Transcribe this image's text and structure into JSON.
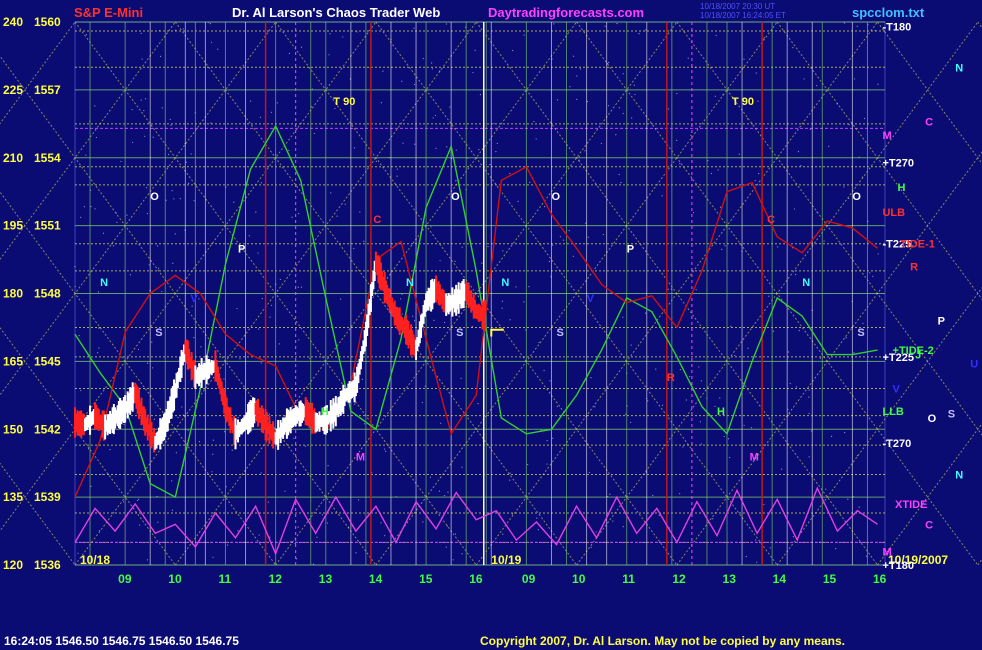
{
  "header": {
    "instrument": "S&P E-Mini",
    "title": "Dr. Al Larson's Chaos Trader Web",
    "site": "Daytradingforecasts.com",
    "timestamp_line1": "10/18/2007 20:30 UT",
    "timestamp_line2": "10/18/2007 16:24:05 ET",
    "filename": "spcclom.txt"
  },
  "footer": {
    "quote": "16:24:05  1546.50  1546.75  1546.50  1546.75",
    "copyright": "Copyright 2007, Dr. Al Larson. May not be copied by any means."
  },
  "colors": {
    "background": "#0b0b74",
    "plot_background": "#0b0b74",
    "grid_yellow": "#e8e85a",
    "grid_green": "#7fd16a",
    "vertical_white": "#ffffff",
    "vertical_red": "#c01818",
    "price_up": "#ffffff",
    "price_down": "#ff2020",
    "green_line": "#30d030",
    "red_line": "#d01010",
    "magenta_line": "#e040e0",
    "title_red": "#ff3030",
    "title_white": "#ffffff",
    "site_magenta": "#ff40ff",
    "filename_cyan": "#40c0ff"
  },
  "chart_data": {
    "type": "line",
    "title": "S&P E-Mini",
    "ylim": [
      1536,
      1560
    ],
    "y_ticks_price": [
      1560,
      1557,
      1554,
      1551,
      1548,
      1545,
      1542,
      1539,
      1536
    ],
    "y_ticks_degrees": [
      240,
      225,
      210,
      195,
      180,
      165,
      150,
      135,
      120
    ],
    "xlim": [
      8.0,
      32.15
    ],
    "x_tick_labels": [
      "09",
      "10",
      "11",
      "12",
      "13",
      "14",
      "15",
      "16",
      "09",
      "10",
      "11",
      "12",
      "13",
      "14",
      "15",
      "16"
    ],
    "x_tick_positions": [
      9,
      10,
      11,
      12,
      13,
      14,
      15,
      16,
      17.05,
      18.05,
      19.05,
      20.05,
      21.05,
      22.05,
      23.05,
      24.05
    ],
    "date_labels": [
      {
        "text": "10/18",
        "x": 8.1
      },
      {
        "text": "10/19",
        "x": 16.3
      },
      {
        "text": "10/19/2007",
        "x": 32.15
      }
    ],
    "series": [
      {
        "name": "",
        "kind": "price",
        "x": [
          8.0,
          8.2,
          8.4,
          8.6,
          8.8,
          9.0,
          9.2,
          9.4,
          9.6,
          9.8,
          10.0,
          10.2,
          10.4,
          10.6,
          10.8,
          11.0,
          11.2,
          11.4,
          11.6,
          11.8,
          12.0,
          12.2,
          12.4,
          12.6,
          12.8,
          13.0,
          13.2,
          13.4,
          13.6,
          13.8,
          14.0,
          14.2,
          14.4,
          14.6,
          14.8,
          15.0,
          15.2,
          15.4,
          15.6,
          15.8,
          16.0,
          16.2
        ],
        "values": [
          1542.3,
          1542.2,
          1542.6,
          1542.1,
          1542.5,
          1542.9,
          1543.6,
          1542.3,
          1541.4,
          1542.2,
          1543.7,
          1545.6,
          1544.3,
          1544.6,
          1544.8,
          1543.0,
          1541.8,
          1542.3,
          1542.9,
          1542.2,
          1541.6,
          1542.2,
          1542.6,
          1542.8,
          1542.3,
          1542.4,
          1542.8,
          1543.5,
          1543.9,
          1546.2,
          1549.4,
          1548.1,
          1547.0,
          1546.4,
          1545.5,
          1547.6,
          1548.2,
          1547.5,
          1547.7,
          1548.1,
          1547.2,
          1547.0
        ]
      },
      {
        "name": "",
        "kind": "green",
        "x": [
          8.0,
          8.5,
          9.0,
          9.5,
          10.0,
          10.5,
          11.0,
          11.5,
          12.0,
          12.5,
          13.0,
          13.5,
          14.0,
          14.5,
          15.0,
          15.5,
          16.0,
          16.5,
          17.0,
          17.5,
          18.0,
          18.5,
          19.0,
          19.5,
          20.0,
          20.5,
          21.0,
          21.5,
          22.0,
          22.5,
          23.0,
          23.5,
          24.0
        ],
        "values": [
          1546.2,
          1544.5,
          1543.0,
          1539.6,
          1539.0,
          1543.8,
          1549.3,
          1553.5,
          1555.4,
          1553.0,
          1547.8,
          1542.8,
          1542.0,
          1546.0,
          1551.8,
          1554.5,
          1549.0,
          1542.5,
          1541.8,
          1542.0,
          1543.5,
          1545.5,
          1547.8,
          1547.2,
          1545.2,
          1543.0,
          1541.8,
          1545.0,
          1547.8,
          1547.0,
          1545.3,
          1545.3,
          1545.5
        ]
      },
      {
        "name": "",
        "kind": "red",
        "x": [
          8.0,
          8.5,
          9.0,
          9.5,
          10.0,
          10.5,
          11.0,
          11.5,
          12.0,
          12.5,
          13.0,
          13.5,
          14.0,
          14.5,
          15.0,
          15.5,
          16.0,
          16.5,
          17.0,
          17.5,
          18.0,
          18.5,
          19.0,
          19.5,
          20.0,
          20.5,
          21.0,
          21.5,
          22.0,
          22.5,
          23.0,
          23.5,
          24.0
        ],
        "values": [
          1539.0,
          1541.5,
          1546.3,
          1548.0,
          1548.8,
          1548.0,
          1546.2,
          1545.3,
          1544.8,
          1542.5,
          1541.9,
          1544.0,
          1549.5,
          1550.3,
          1546.0,
          1541.8,
          1543.5,
          1553.0,
          1553.6,
          1551.5,
          1550.0,
          1548.4,
          1547.6,
          1547.9,
          1546.5,
          1549.0,
          1552.5,
          1552.9,
          1550.5,
          1549.8,
          1551.2,
          1550.9,
          1550.0
        ]
      },
      {
        "name": "",
        "kind": "magenta",
        "x": [
          8.0,
          8.4,
          8.8,
          9.2,
          9.6,
          10.0,
          10.4,
          10.8,
          11.2,
          11.6,
          12.0,
          12.4,
          12.8,
          13.2,
          13.6,
          14.0,
          14.4,
          14.8,
          15.2,
          15.6,
          16.0,
          16.4,
          16.8,
          17.2,
          17.6,
          18.0,
          18.4,
          18.8,
          19.2,
          19.6,
          20.0,
          20.4,
          20.8,
          21.2,
          21.6,
          22.0,
          22.4,
          22.8,
          23.2,
          23.6,
          24.0
        ],
        "values": [
          1537.0,
          1538.5,
          1537.5,
          1538.7,
          1537.4,
          1537.8,
          1536.8,
          1538.3,
          1537.2,
          1538.6,
          1536.5,
          1538.9,
          1537.4,
          1539.0,
          1537.5,
          1538.6,
          1537.0,
          1538.8,
          1537.6,
          1539.2,
          1538.0,
          1538.4,
          1537.1,
          1537.9,
          1536.9,
          1538.6,
          1537.2,
          1539.0,
          1537.4,
          1538.5,
          1537.0,
          1538.8,
          1537.3,
          1539.3,
          1537.4,
          1538.9,
          1537.1,
          1539.4,
          1537.5,
          1538.4,
          1537.8
        ]
      }
    ],
    "annotations": [
      {
        "text": "T 90",
        "x": 13.15,
        "y": 1556.5,
        "color": "#ffff40"
      },
      {
        "text": "T 90",
        "x": 21.1,
        "y": 1556.5,
        "color": "#ffff40"
      },
      {
        "text": "-T180",
        "x": 24.1,
        "y": 1559.8,
        "color": "#ffffff"
      },
      {
        "text": "+T270",
        "x": 24.1,
        "y": 1553.8,
        "color": "#ffffff"
      },
      {
        "text": "-T225",
        "x": 24.1,
        "y": 1550.2,
        "color": "#ffffff"
      },
      {
        "text": "+T225",
        "x": 24.1,
        "y": 1545.2,
        "color": "#ffffff"
      },
      {
        "text": "-T270",
        "x": 24.1,
        "y": 1541.4,
        "color": "#ffffff"
      },
      {
        "text": "+T180",
        "x": 24.1,
        "y": 1536.0,
        "color": "#ffffff"
      },
      {
        "text": "M",
        "x": 24.1,
        "y": 1555.0,
        "color": "#ff40ff"
      },
      {
        "text": "H",
        "x": 24.4,
        "y": 1552.7,
        "color": "#40ff40"
      },
      {
        "text": "ULB",
        "x": 24.1,
        "y": 1551.6,
        "color": "#ff3030"
      },
      {
        "text": "TIDE-1",
        "x": 24.45,
        "y": 1550.2,
        "color": "#ff3030"
      },
      {
        "text": "R",
        "x": 24.65,
        "y": 1549.2,
        "color": "#ff3030"
      },
      {
        "text": "+TIDE-2",
        "x": 24.3,
        "y": 1545.5,
        "color": "#40ff40"
      },
      {
        "text": "V",
        "x": 24.3,
        "y": 1543.8,
        "color": "#3030ff"
      },
      {
        "text": "LLB",
        "x": 24.1,
        "y": 1542.8,
        "color": "#40ff40"
      },
      {
        "text": "O",
        "x": 25.0,
        "y": 1542.5,
        "color": "#ffffff"
      },
      {
        "text": "S",
        "x": 25.4,
        "y": 1542.7,
        "color": "#c0c0ff"
      },
      {
        "text": "P",
        "x": 25.2,
        "y": 1546.8,
        "color": "#ffffff"
      },
      {
        "text": "U",
        "x": 25.85,
        "y": 1544.9,
        "color": "#3030ff"
      },
      {
        "text": "J",
        "x": 24.75,
        "y": 1545.3,
        "color": "#40ff40"
      },
      {
        "text": "N",
        "x": 25.55,
        "y": 1558.0,
        "color": "#40ffff"
      },
      {
        "text": "C",
        "x": 24.95,
        "y": 1555.6,
        "color": "#ff40ff"
      },
      {
        "text": "N",
        "x": 25.55,
        "y": 1540.0,
        "color": "#40ffff"
      },
      {
        "text": "XTIDE",
        "x": 24.35,
        "y": 1538.7,
        "color": "#ff40ff"
      },
      {
        "text": "C",
        "x": 24.95,
        "y": 1537.8,
        "color": "#ff40ff"
      },
      {
        "text": "M",
        "x": 24.1,
        "y": 1536.6,
        "color": "#ff40ff"
      },
      {
        "text": "O",
        "x": 9.5,
        "y": 1552.3,
        "color": "#ffffff"
      },
      {
        "text": "O",
        "x": 15.5,
        "y": 1552.3,
        "color": "#ffffff"
      },
      {
        "text": "O",
        "x": 17.5,
        "y": 1552.3,
        "color": "#ffffff"
      },
      {
        "text": "O",
        "x": 23.5,
        "y": 1552.3,
        "color": "#ffffff"
      },
      {
        "text": "P",
        "x": 11.25,
        "y": 1550.0,
        "color": "#ffffff"
      },
      {
        "text": "P",
        "x": 19.0,
        "y": 1550.0,
        "color": "#ffffff"
      },
      {
        "text": "N",
        "x": 8.5,
        "y": 1548.5,
        "color": "#40ffff"
      },
      {
        "text": "N",
        "x": 14.6,
        "y": 1548.5,
        "color": "#40ffff"
      },
      {
        "text": "N",
        "x": 16.5,
        "y": 1548.5,
        "color": "#40ffff"
      },
      {
        "text": "N",
        "x": 22.5,
        "y": 1548.5,
        "color": "#40ffff"
      },
      {
        "text": "S",
        "x": 9.6,
        "y": 1546.3,
        "color": "#c0c0ff"
      },
      {
        "text": "S",
        "x": 15.6,
        "y": 1546.3,
        "color": "#c0c0ff"
      },
      {
        "text": "S",
        "x": 17.6,
        "y": 1546.3,
        "color": "#c0c0ff"
      },
      {
        "text": "S",
        "x": 23.6,
        "y": 1546.3,
        "color": "#c0c0ff"
      },
      {
        "text": "C",
        "x": 13.95,
        "y": 1551.3,
        "color": "#ff3030"
      },
      {
        "text": "C",
        "x": 21.8,
        "y": 1551.3,
        "color": "#ff3030"
      },
      {
        "text": "M",
        "x": 13.6,
        "y": 1540.8,
        "color": "#ff40ff"
      },
      {
        "text": "M",
        "x": 21.45,
        "y": 1540.8,
        "color": "#ff40ff"
      },
      {
        "text": "H",
        "x": 12.9,
        "y": 1542.8,
        "color": "#40ff40"
      },
      {
        "text": "H",
        "x": 20.8,
        "y": 1542.8,
        "color": "#40ff40"
      },
      {
        "text": "R",
        "x": 19.8,
        "y": 1544.3,
        "color": "#ff3030"
      },
      {
        "text": "V",
        "x": 10.3,
        "y": 1547.8,
        "color": "#3030ff"
      },
      {
        "text": "V",
        "x": 18.2,
        "y": 1547.8,
        "color": "#3030ff"
      }
    ],
    "grid": true,
    "legend": "none"
  }
}
